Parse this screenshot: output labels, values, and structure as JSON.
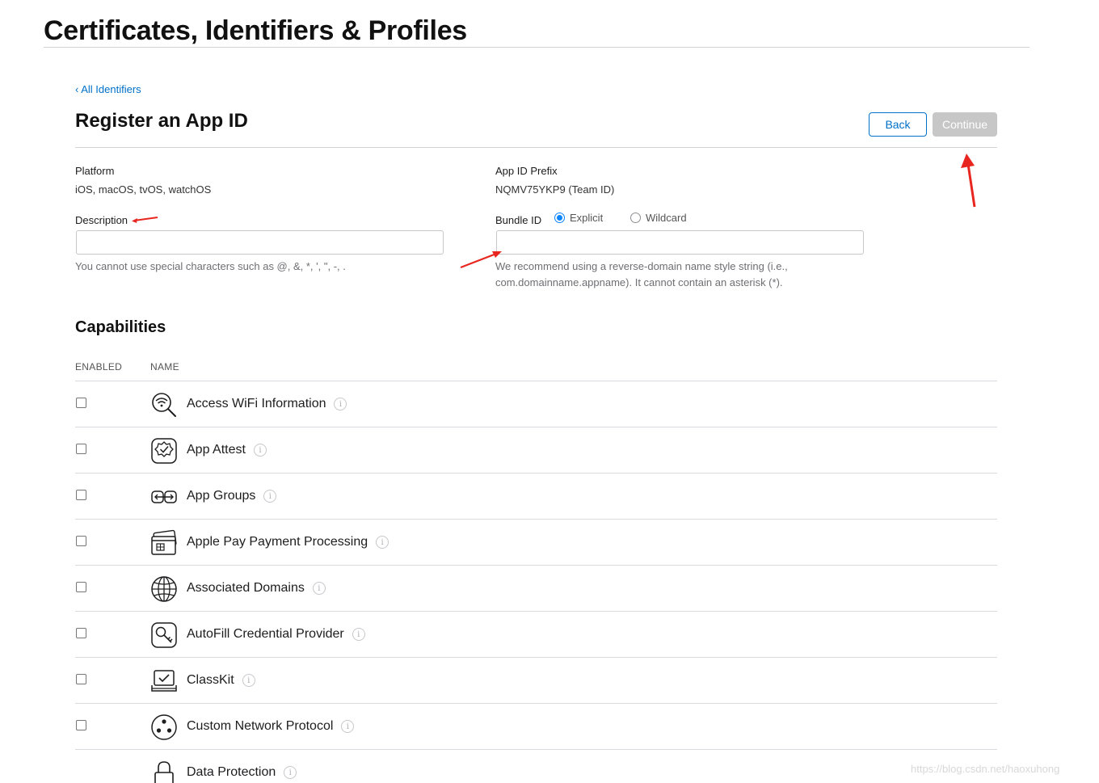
{
  "page": {
    "title": "Certificates, Identifiers & Profiles",
    "breadcrumb": "‹ All Identifiers",
    "section_title": "Register an App ID"
  },
  "toolbar": {
    "back_label": "Back",
    "continue_label": "Continue"
  },
  "platform": {
    "label": "Platform",
    "value": "iOS, macOS, tvOS, watchOS"
  },
  "prefix": {
    "label": "App ID Prefix",
    "value": "NQMV75YKP9 (Team ID)"
  },
  "description": {
    "label": "Description",
    "value": "",
    "placeholder": "",
    "hint": "You cannot use special characters such as @, &, *, ', \", -, ."
  },
  "bundle": {
    "label": "Bundle ID",
    "explicit_label": "Explicit",
    "wildcard_label": "Wildcard",
    "selected": "Explicit",
    "value": "",
    "hint_line1": "We recommend using a reverse-domain name style string (i.e.,",
    "hint_line2": "com.domainname.appname). It cannot contain an asterisk (*)."
  },
  "capabilities": {
    "title": "Capabilities",
    "col_enabled": "ENABLED",
    "col_name": "NAME",
    "items": [
      {
        "name": "Access WiFi Information",
        "icon": "wifi-search-icon",
        "enabled": false
      },
      {
        "name": "App Attest",
        "icon": "badge-check-icon",
        "enabled": false
      },
      {
        "name": "App Groups",
        "icon": "app-groups-icon",
        "enabled": false
      },
      {
        "name": "Apple Pay Payment Processing",
        "icon": "credit-card-icon",
        "enabled": false
      },
      {
        "name": "Associated Domains",
        "icon": "globe-icon",
        "enabled": false
      },
      {
        "name": "AutoFill Credential Provider",
        "icon": "key-icon",
        "enabled": false
      },
      {
        "name": "ClassKit",
        "icon": "classkit-icon",
        "enabled": false
      },
      {
        "name": "Custom Network Protocol",
        "icon": "network-dots-icon",
        "enabled": false
      },
      {
        "name": "Data Protection",
        "icon": "lock-icon",
        "enabled": false
      }
    ]
  },
  "info_glyph": "i",
  "watermark": "https://blog.csdn.net/haoxuhong",
  "colors": {
    "accent": "#0070c9",
    "annotation": "#e8261f",
    "continue_disabled": "#c7c7c7"
  }
}
